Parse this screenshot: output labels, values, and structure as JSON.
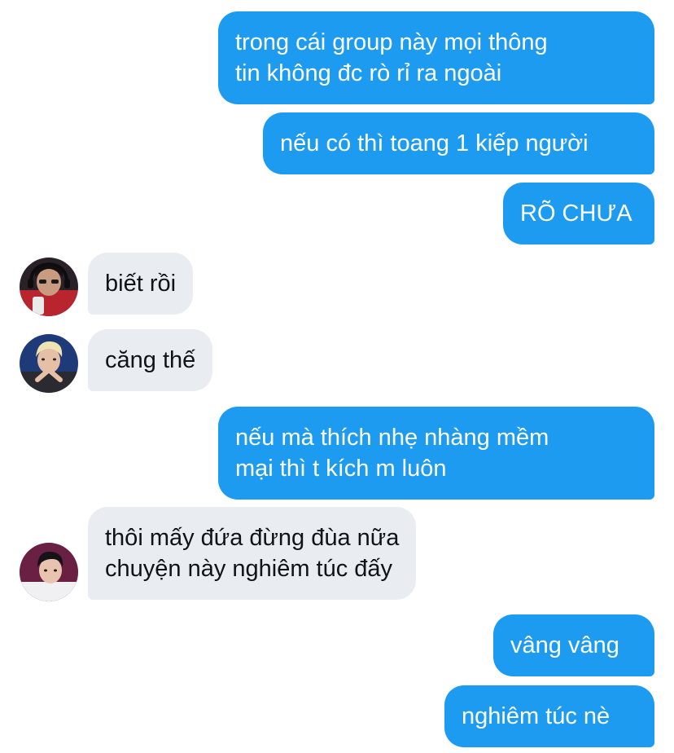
{
  "messages": [
    {
      "id": "m1",
      "direction": "outgoing",
      "text": "trong cái group này mọi thông\ntin không đc rò rỉ ra ngoài"
    },
    {
      "id": "m2",
      "direction": "outgoing",
      "text": "nếu có thì toang 1 kiếp người"
    },
    {
      "id": "m3",
      "direction": "outgoing",
      "text": "RÕ CHƯA"
    },
    {
      "id": "m4",
      "direction": "incoming",
      "sender_avatar": "avatar-person-headset",
      "text": "biết rồi"
    },
    {
      "id": "m5",
      "direction": "incoming",
      "sender_avatar": "avatar-person-blonde",
      "text": "căng thế"
    },
    {
      "id": "m6",
      "direction": "outgoing",
      "text": "nếu mà thích nhẹ nhàng mềm\nmại thì t kích m luôn"
    },
    {
      "id": "m7",
      "direction": "incoming",
      "sender_avatar": "avatar-person-dark-hair",
      "text": "thôi mấy đứa đừng đùa nữa\nchuyện này nghiêm túc đấy"
    },
    {
      "id": "m8",
      "direction": "outgoing",
      "text": "vâng vâng"
    },
    {
      "id": "m9",
      "direction": "outgoing",
      "text": "nghiêm túc nè"
    }
  ],
  "colors": {
    "outgoing_bubble": "#1d9bf0",
    "outgoing_text": "#ffffff",
    "incoming_bubble": "#e9edf1",
    "incoming_text": "#0f1419"
  }
}
